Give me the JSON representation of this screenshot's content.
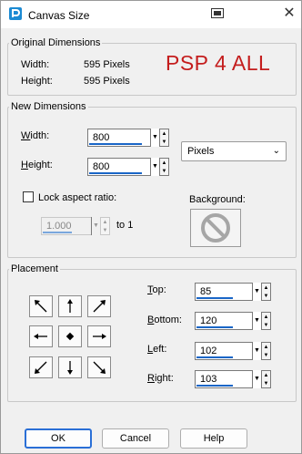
{
  "window": {
    "title": "Canvas Size"
  },
  "original": {
    "legend": "Original Dimensions",
    "width_label": "Width:",
    "width_value": "595 Pixels",
    "height_label": "Height:",
    "height_value": "595 Pixels",
    "watermark": "PSP 4 ALL"
  },
  "new_dims": {
    "legend": "New Dimensions",
    "width_label": "Width:",
    "width_value": "800",
    "height_label": "Height:",
    "height_value": "800",
    "units": "Pixels",
    "lock_label": "Lock aspect ratio:",
    "lock_checked": false,
    "ratio_value": "1.000",
    "to_label": "to 1",
    "background_label": "Background:"
  },
  "placement": {
    "legend": "Placement",
    "top_label": "Top:",
    "top_value": "85",
    "bottom_label": "Bottom:",
    "bottom_value": "120",
    "left_label": "Left:",
    "left_value": "102",
    "right_label": "Right:",
    "right_value": "103",
    "anchors": [
      "anchor-top-left",
      "anchor-top",
      "anchor-top-right",
      "anchor-left",
      "anchor-center",
      "anchor-right",
      "anchor-bottom-left",
      "anchor-bottom",
      "anchor-bottom-right"
    ]
  },
  "buttons": {
    "ok": "OK",
    "cancel": "Cancel",
    "help": "Help"
  },
  "colors": {
    "accent": "#1a66c7",
    "watermark": "#c41d1d"
  }
}
